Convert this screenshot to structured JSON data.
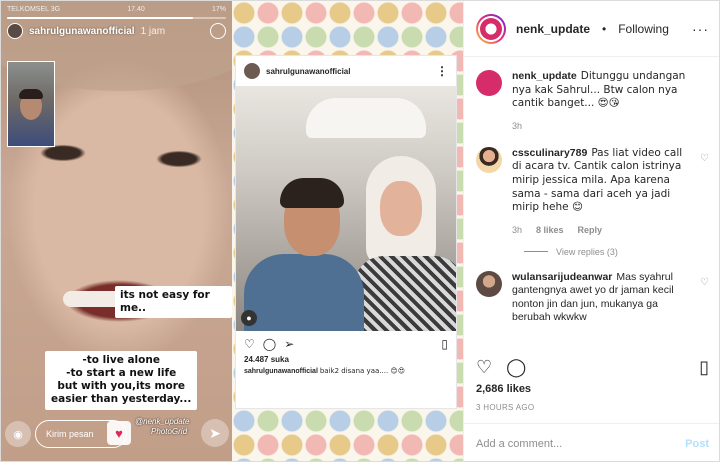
{
  "story": {
    "carrier": "TELKOMSEL  3G",
    "clock": "17.40",
    "battery": "17%",
    "progress": 0.85,
    "username": "sahrulgunawanofficial",
    "time": "1 jam",
    "sticker_1": "its not easy for me..",
    "sticker_2_lines": [
      "-to live alone",
      "-to start a new life",
      "but with you,its more",
      "easier than yesterday..."
    ],
    "reply_placeholder": "Kirim pesan",
    "watermark_handle": "@nenk_update",
    "watermark_app": "PhotoGrid"
  },
  "post_card": {
    "username": "sahrulgunawanofficial",
    "more": "⋮",
    "likes": "24.487 suka",
    "caption_user": "sahrulgunawanofficial",
    "caption_text": "baik2 disana yaa.... 😊😍"
  },
  "ig": {
    "account": "nenk_update",
    "separator": "•",
    "follow_status": "Following",
    "more": "···",
    "comments": [
      {
        "user": "nenk_update",
        "text": "Ditunggu undangan nya kak Sahrul... Btw calon nya cantik banget... 😍😘",
        "time": "3h"
      },
      {
        "user": "cssculinary789",
        "text": "Pas liat video call di acara tv. Cantik calon istrinya mirip jessica mila. Apa karena sama - sama dari aceh ya jadi mirip hehe 😊",
        "time": "3h",
        "likes": "8 likes",
        "reply": "Reply",
        "view_replies": "View replies (3)"
      },
      {
        "user": "wulansarijudeanwar",
        "text": "Mas syahrul gantengnya awet yo dr jaman kecil nonton jin dan jun, mukanya ga berubah wkwkw"
      }
    ],
    "likes_count": "2,686 likes",
    "posted_ago": "3 HOURS AGO",
    "add_comment_placeholder": "Add a comment...",
    "post_button": "Post"
  }
}
